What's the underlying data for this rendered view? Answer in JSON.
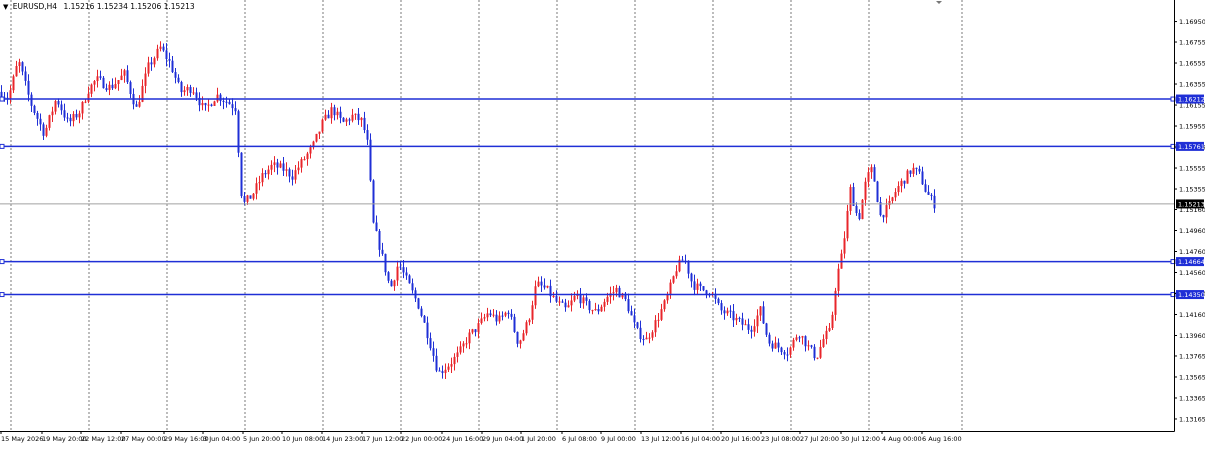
{
  "symbol_info": {
    "symbol": "EURUSD,H4",
    "ohlc": "1.15216 1.15234 1.15206 1.15213"
  },
  "colors": {
    "bull": "#e8262b",
    "bear": "#1f2fd6",
    "hline": "#1f2fd6",
    "grid": "#5a5a5a",
    "last_line": "#a0a0a0",
    "label_bg": "#1f2fd6",
    "label_text": "#ffffff"
  },
  "icons": {
    "menu": "triangle-down-icon"
  },
  "chart_data": {
    "type": "candlestick",
    "symbol": "EURUSD",
    "timeframe": "H4",
    "ylim": [
      1.1306,
      1.1706
    ],
    "y_ticks": [
      "1.16950",
      "1.16755",
      "1.16555",
      "1.16355",
      "1.16155",
      "1.15955",
      "1.15755",
      "1.15555",
      "1.15355",
      "1.15160",
      "1.14960",
      "1.14760",
      "1.14560",
      "1.14360",
      "1.14160",
      "1.13960",
      "1.13765",
      "1.13565",
      "1.13365",
      "1.13165"
    ],
    "x_labels": [
      "15 May 2026",
      "19 May 20:00",
      "22 May 12:00",
      "27 May 00:00",
      "29 May 16:00",
      "3 Jun 04:00",
      "5 Jun 20:00",
      "10 Jun 08:00",
      "14 Jun 23:00",
      "17 Jun 12:00",
      "22 Jun 00:00",
      "24 Jun 16:00",
      "29 Jun 04:00",
      "1 Jul 20:00",
      "6 Jul 08:00",
      "9 Jul 00:00",
      "13 Jul 12:00",
      "16 Jul 04:00",
      "20 Jul 16:00",
      "23 Jul 08:00",
      "27 Jul 20:00",
      "30 Jul 12:00",
      "4 Aug 00:00",
      "6 Aug 16:00"
    ],
    "horizontal_levels": [
      {
        "value": 1.16212,
        "label": "1.16212"
      },
      {
        "value": 1.15761,
        "label": "1.15761"
      },
      {
        "value": 1.14664,
        "label": "1.14664"
      },
      {
        "value": 1.1435,
        "label": "1.14350"
      }
    ],
    "last_price": {
      "value": 1.15213,
      "label": "1.15213"
    },
    "close_path": [
      [
        0,
        1.1628
      ],
      [
        8,
        1.1622
      ],
      [
        18,
        1.1658
      ],
      [
        30,
        1.1618
      ],
      [
        44,
        1.1588
      ],
      [
        56,
        1.1622
      ],
      [
        68,
        1.1598
      ],
      [
        80,
        1.161
      ],
      [
        88,
        1.163
      ],
      [
        96,
        1.164
      ],
      [
        110,
        1.1632
      ],
      [
        124,
        1.1645
      ],
      [
        136,
        1.1612
      ],
      [
        148,
        1.1652
      ],
      [
        160,
        1.167
      ],
      [
        170,
        1.1655
      ],
      [
        180,
        1.1628
      ],
      [
        192,
        1.1632
      ],
      [
        204,
        1.161
      ],
      [
        216,
        1.1625
      ],
      [
        228,
        1.1618
      ],
      [
        236,
        1.1612
      ],
      [
        240,
        1.1535
      ],
      [
        244,
        1.1522
      ],
      [
        252,
        1.153
      ],
      [
        262,
        1.1548
      ],
      [
        272,
        1.1558
      ],
      [
        282,
        1.1555
      ],
      [
        292,
        1.1548
      ],
      [
        302,
        1.1562
      ],
      [
        312,
        1.1575
      ],
      [
        322,
        1.1598
      ],
      [
        332,
        1.1612
      ],
      [
        342,
        1.1598
      ],
      [
        352,
        1.1605
      ],
      [
        362,
        1.16
      ],
      [
        368,
        1.1575
      ],
      [
        372,
        1.1505
      ],
      [
        380,
        1.1478
      ],
      [
        390,
        1.144
      ],
      [
        398,
        1.1465
      ],
      [
        408,
        1.1445
      ],
      [
        418,
        1.1425
      ],
      [
        428,
        1.1395
      ],
      [
        438,
        1.136
      ],
      [
        448,
        1.1368
      ],
      [
        458,
        1.1378
      ],
      [
        468,
        1.1395
      ],
      [
        478,
        1.1405
      ],
      [
        488,
        1.1418
      ],
      [
        498,
        1.141
      ],
      [
        508,
        1.142
      ],
      [
        518,
        1.1388
      ],
      [
        528,
        1.141
      ],
      [
        536,
        1.1445
      ],
      [
        546,
        1.144
      ],
      [
        556,
        1.1428
      ],
      [
        566,
        1.142
      ],
      [
        576,
        1.1435
      ],
      [
        586,
        1.1425
      ],
      [
        596,
        1.1418
      ],
      [
        606,
        1.1432
      ],
      [
        616,
        1.144
      ],
      [
        626,
        1.1428
      ],
      [
        636,
        1.14
      ],
      [
        646,
        1.1392
      ],
      [
        656,
        1.141
      ],
      [
        666,
        1.143
      ],
      [
        676,
        1.146
      ],
      [
        684,
        1.147
      ],
      [
        692,
        1.1445
      ],
      [
        700,
        1.144
      ],
      [
        710,
        1.1438
      ],
      [
        720,
        1.142
      ],
      [
        730,
        1.1415
      ],
      [
        740,
        1.1408
      ],
      [
        750,
        1.1402
      ],
      [
        760,
        1.142
      ],
      [
        768,
        1.139
      ],
      [
        778,
        1.1385
      ],
      [
        788,
        1.138
      ],
      [
        798,
        1.14
      ],
      [
        808,
        1.1385
      ],
      [
        816,
        1.1375
      ],
      [
        824,
        1.1395
      ],
      [
        830,
        1.14
      ],
      [
        836,
        1.145
      ],
      [
        842,
        1.1475
      ],
      [
        850,
        1.1535
      ],
      [
        858,
        1.1505
      ],
      [
        866,
        1.1545
      ],
      [
        872,
        1.1555
      ],
      [
        880,
        1.151
      ],
      [
        888,
        1.1518
      ],
      [
        896,
        1.1535
      ],
      [
        904,
        1.1545
      ],
      [
        912,
        1.1555
      ],
      [
        920,
        1.1548
      ],
      [
        926,
        1.1532
      ],
      [
        934,
        1.15213
      ]
    ]
  }
}
